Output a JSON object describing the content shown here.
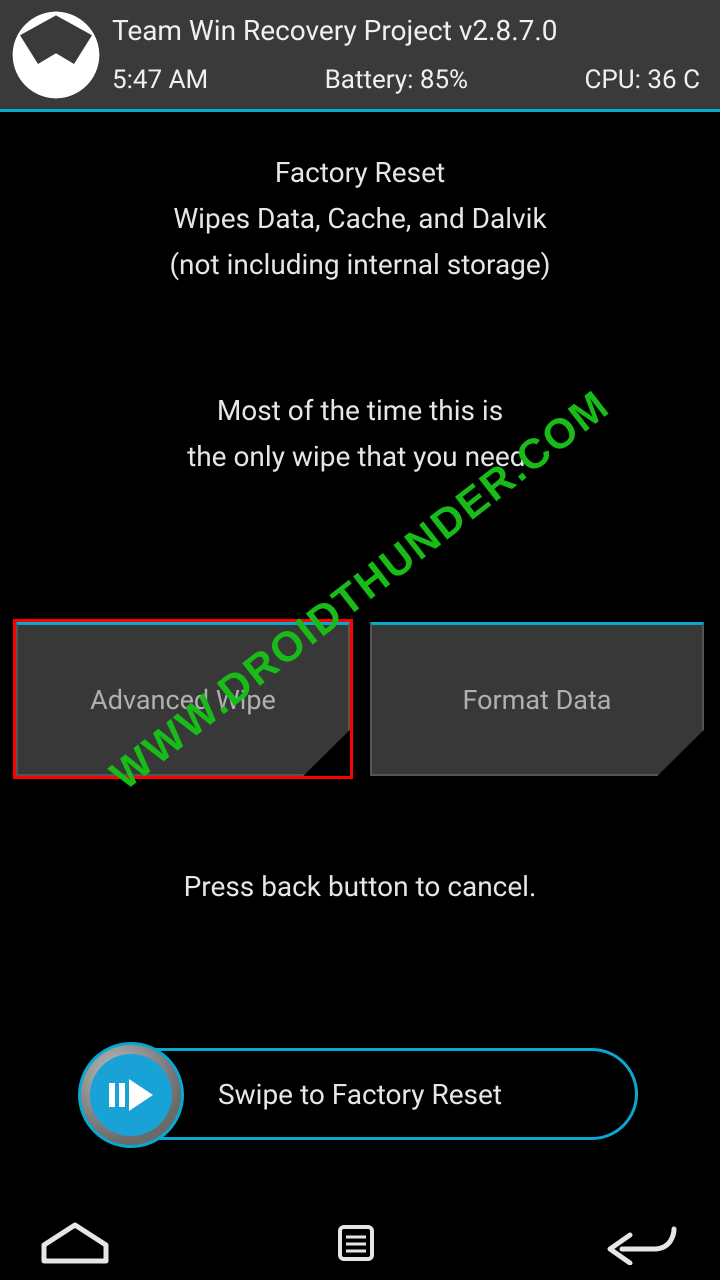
{
  "header": {
    "title": "Team Win Recovery Project  v2.8.7.0",
    "time": "5:47 AM",
    "battery": "Battery: 85%",
    "cpu": "CPU: 36 C"
  },
  "body": {
    "l1": "Factory Reset",
    "l2": "Wipes Data, Cache, and Dalvik",
    "l3": "(not including internal storage)",
    "l4": "Most of the time this is",
    "l5": "the only wipe that you need."
  },
  "buttons": {
    "advanced": "Advanced Wipe",
    "format": "Format Data"
  },
  "hint": "Press back button to cancel.",
  "slider": {
    "label": "Swipe to Factory Reset"
  },
  "watermark": "WWW.DROIDTHUNDER.COM"
}
